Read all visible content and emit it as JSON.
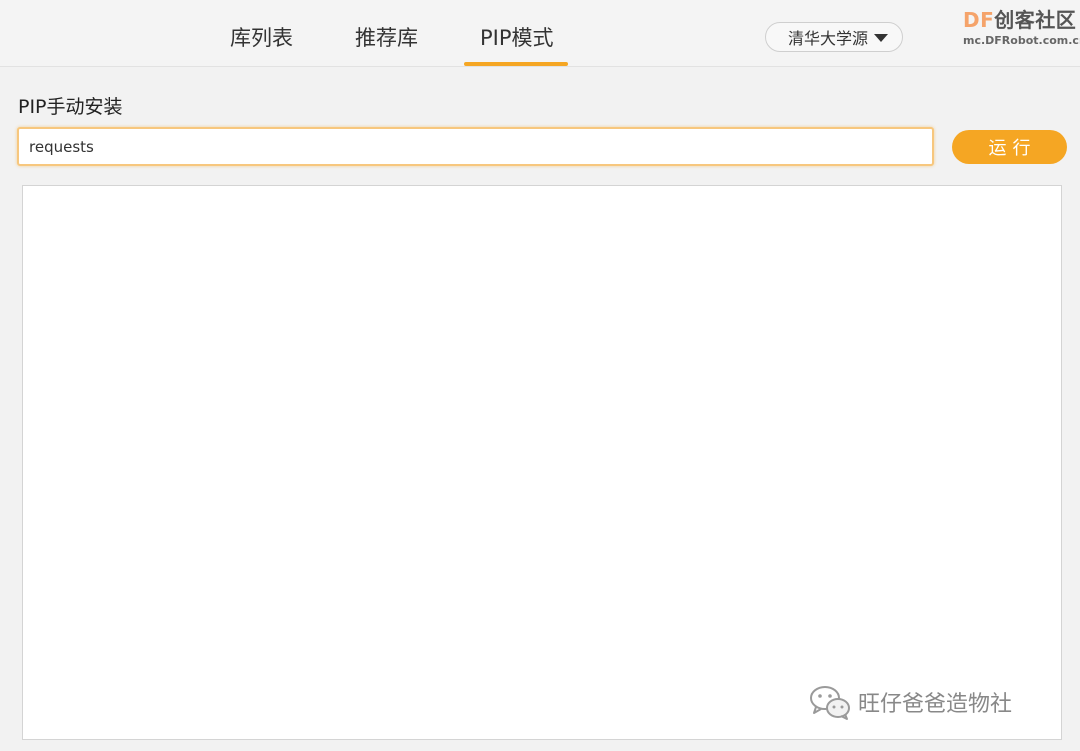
{
  "tabs": {
    "libs": "库列表",
    "recommended": "推荐库",
    "pip": "PIP模式"
  },
  "source_select": {
    "value": "清华大学源"
  },
  "logo": {
    "prefix": "DF",
    "name": "创客社区",
    "site": "mc.DFRobot.com.cn"
  },
  "section": {
    "title": "PIP手动安装"
  },
  "command_input": {
    "value": "requests"
  },
  "run_button": {
    "label": "运行"
  },
  "watermark": {
    "text": "旺仔爸爸造物社"
  },
  "colors": {
    "accent": "#f5a623",
    "input_border": "#f7c77e"
  }
}
